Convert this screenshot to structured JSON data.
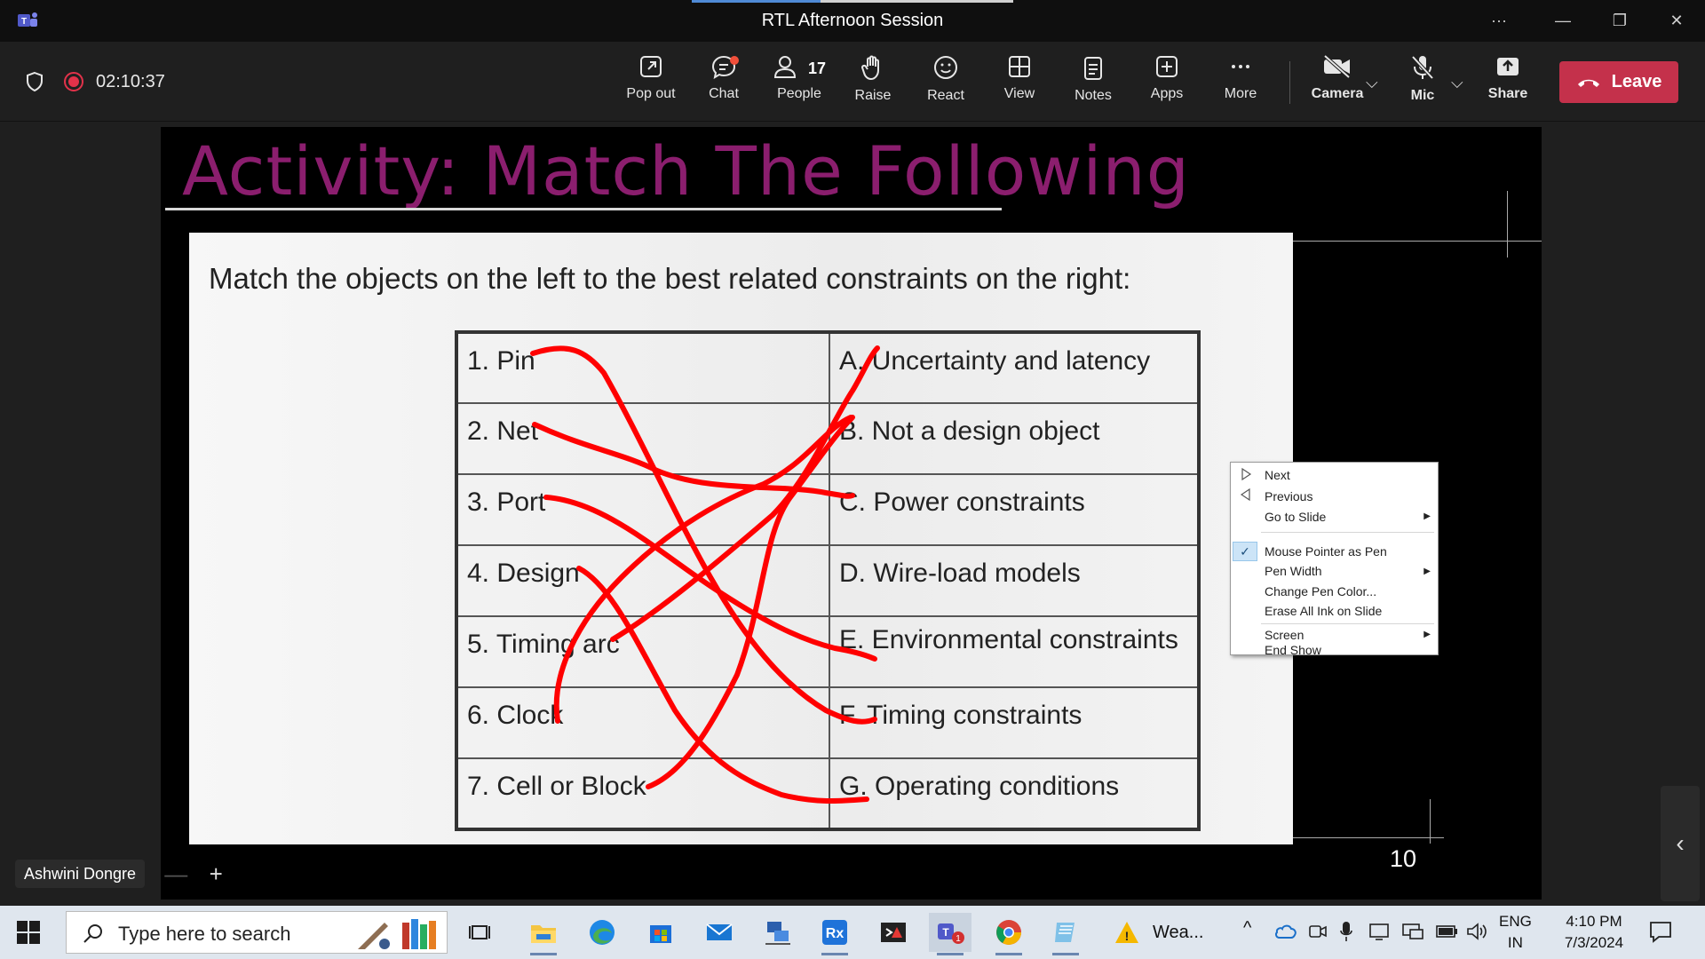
{
  "window": {
    "title": "RTL Afternoon Session"
  },
  "meeting": {
    "timer": "02:10:37",
    "toolbar": {
      "popout": "Pop out",
      "chat": "Chat",
      "people": "People",
      "people_count": "17",
      "raise": "Raise",
      "react": "React",
      "view": "View",
      "notes": "Notes",
      "apps": "Apps",
      "more": "More",
      "camera": "Camera",
      "mic": "Mic",
      "share": "Share",
      "leave": "Leave"
    },
    "participant_name": "Ashwini Dongre",
    "zoom_out": "—",
    "zoom_in": "+"
  },
  "slide": {
    "title": "Activity: Match The Following",
    "instruction": "Match the objects on the left to the best related constraints on the right:",
    "page_number": "10",
    "rows": [
      {
        "left": "1. Pin",
        "right": "A. Uncertainty and latency"
      },
      {
        "left": "2. Net",
        "right": "B. Not a design object"
      },
      {
        "left": "3. Port",
        "right": "C. Power constraints"
      },
      {
        "left": "4. Design",
        "right": "D. Wire-load models"
      },
      {
        "left": "5. Timing arc",
        "right": "E. Environmental constraints"
      },
      {
        "left": "6. Clock",
        "right": "F. Timing constraints"
      },
      {
        "left": "7. Cell or Block",
        "right": "G. Operating conditions"
      }
    ],
    "ink_color": "#ff0000"
  },
  "context_menu": {
    "next": "Next",
    "previous": "Previous",
    "go_to_slide": "Go to Slide",
    "mouse_pointer_as_pen": "Mouse Pointer as Pen",
    "pen_width": "Pen Width",
    "change_pen_color": "Change Pen Color...",
    "erase_all_ink": "Erase All Ink on Slide",
    "screen": "Screen",
    "end_show": "End Show"
  },
  "taskbar": {
    "search_placeholder": "Type here to search",
    "weather": "Wea...",
    "teams_badge": "1",
    "lang_line1": "ENG",
    "lang_line2": "IN",
    "time": "4:10 PM",
    "date": "7/3/2024"
  },
  "colors": {
    "leave": "#c4314b",
    "accent": "#4f8ad6",
    "title_magenta": "#8b1e6e"
  }
}
